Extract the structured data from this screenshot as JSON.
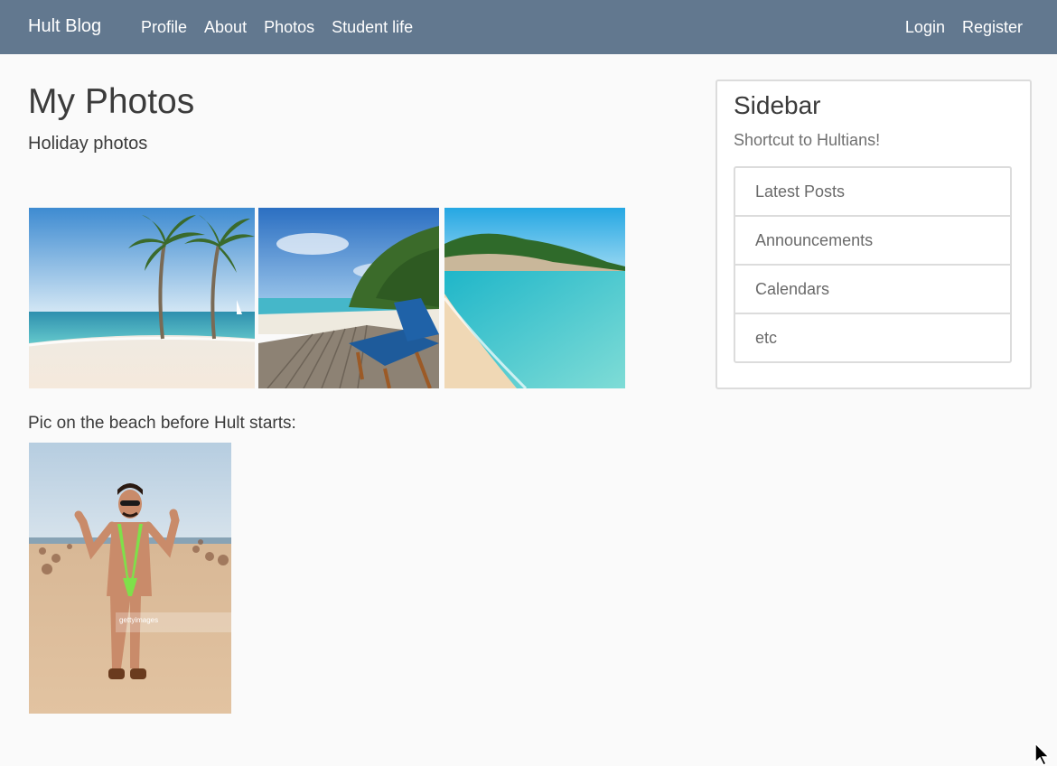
{
  "navbar": {
    "brand": "Hult Blog",
    "links": [
      "Profile",
      "About",
      "Photos",
      "Student life"
    ],
    "auth": {
      "login": "Login",
      "register": "Register"
    }
  },
  "main": {
    "title": "My Photos",
    "subtitle": "Holiday photos",
    "caption": "Pic on the beach before Hult starts:",
    "watermark": "gettyimages"
  },
  "sidebar": {
    "title": "Sidebar",
    "subtitle": "Shortcut to Hultians!",
    "items": [
      "Latest Posts",
      "Announcements",
      "Calendars",
      "etc"
    ]
  },
  "colors": {
    "navbar": "#62788f",
    "background": "#fafafa",
    "border": "#dcdcdc"
  }
}
